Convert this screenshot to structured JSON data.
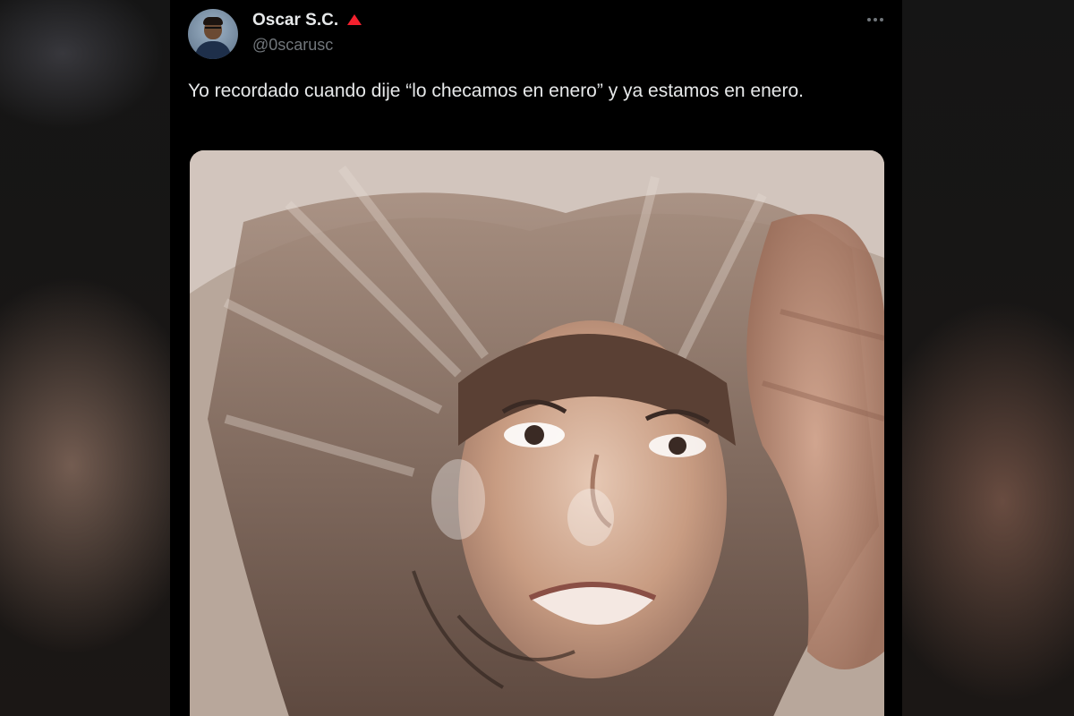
{
  "tweet": {
    "author": {
      "display_name": "Oscar S.C.",
      "handle": "@0scarusc",
      "badge_icon": "red-triangle-icon",
      "badge_color": "#f4212e"
    },
    "text": "Yo recordado cuando dije “lo checamos en enero” y ya estamos en enero.",
    "more_icon": "more-horizontal-icon",
    "media": {
      "type": "photo",
      "subject_icon": "photo-of-woman-with-windblown-hair"
    }
  },
  "colors": {
    "background": "#000000",
    "text_primary": "#e7e9ea",
    "text_secondary": "#71767b"
  }
}
